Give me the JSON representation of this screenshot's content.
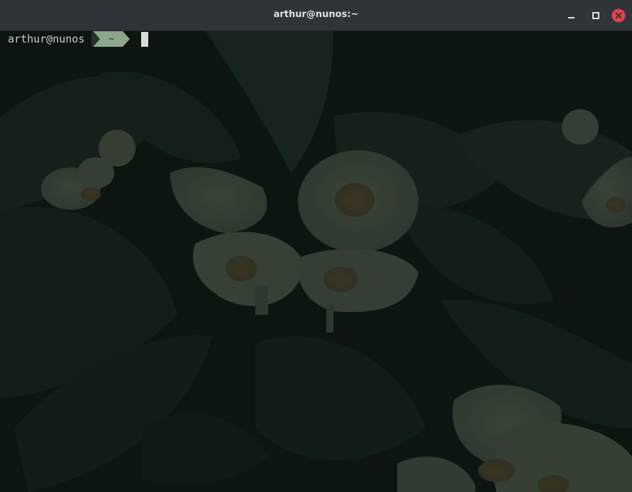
{
  "window": {
    "title": "arthur@nunos:~",
    "controls": {
      "minimize": "minimize-icon",
      "maximize": "maximize-icon",
      "close": "close-icon",
      "close_color": "#e5434b"
    }
  },
  "terminal": {
    "prompt_user": "arthur@nunos",
    "prompt_dir": "~",
    "prompt_segment_color": "#8da58a",
    "cursor": "block",
    "background": "dark photo of white flowers and leaves"
  }
}
